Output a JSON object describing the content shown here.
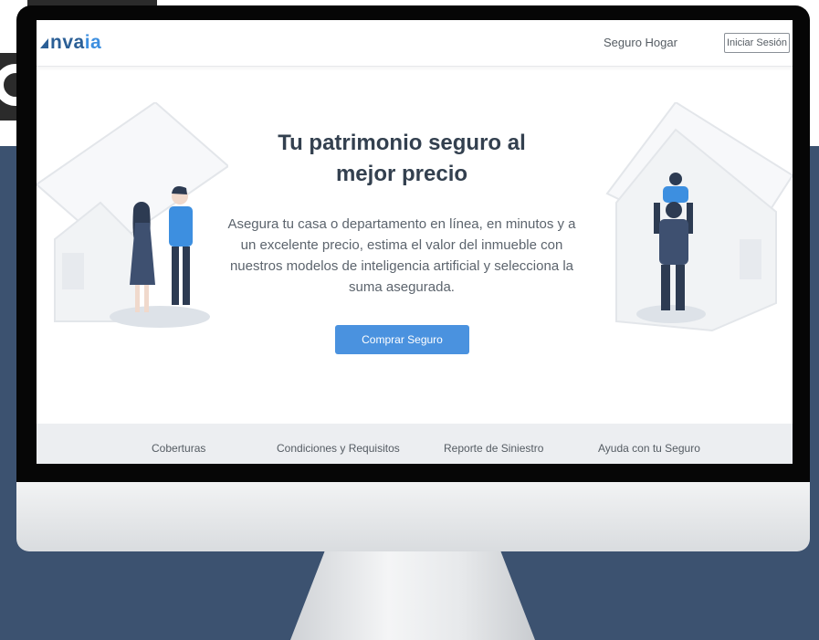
{
  "brand": {
    "logo_text_main": "nva",
    "logo_text_accent": "ia"
  },
  "nav": {
    "link_label": "Seguro Hogar",
    "login_label": "Iniciar Sesión"
  },
  "hero": {
    "title_line1": "Tu patrimonio seguro al",
    "title_line2": "mejor precio",
    "subtitle": "Asegura tu casa o departamento en línea, en minutos y a un excelente precio, estima el valor del inmueble con nuestros modelos de inteligencia artificial y selecciona la suma asegurada.",
    "cta_label": "Comprar Seguro"
  },
  "footer": {
    "items": [
      {
        "label": "Coberturas"
      },
      {
        "label": "Condiciones y Requisitos"
      },
      {
        "label": "Reporte de Siniestro"
      },
      {
        "label": "Ayuda con tu Seguro"
      }
    ]
  },
  "colors": {
    "backdrop": "#3c5270",
    "brand": "#2b5f96",
    "brand_accent": "#3d8fe0",
    "cta": "#4a92df",
    "title": "#33404f"
  },
  "icons": [
    "house-mark-icon",
    "house-couple-illustration",
    "house-family-illustration"
  ]
}
